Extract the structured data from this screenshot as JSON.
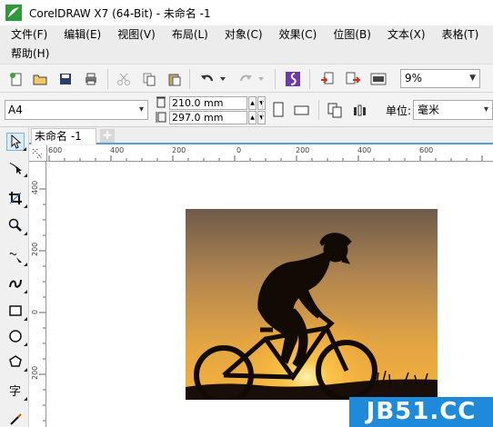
{
  "window": {
    "title": "CorelDRAW X7 (64-Bit) - 未命名 -1"
  },
  "menubar": {
    "row1": [
      {
        "label": "文件(F)"
      },
      {
        "label": "编辑(E)"
      },
      {
        "label": "视图(V)"
      },
      {
        "label": "布局(L)"
      },
      {
        "label": "对象(C)"
      },
      {
        "label": "效果(C)"
      },
      {
        "label": "位图(B)"
      },
      {
        "label": "文本(X)"
      },
      {
        "label": "表格(T)"
      }
    ],
    "row2": [
      {
        "label": "帮助(H)"
      }
    ]
  },
  "toolbar": {
    "zoom": "9%",
    "icons": [
      "new-icon",
      "open-icon",
      "save-icon",
      "print-icon",
      "cut-icon",
      "copy-icon",
      "paste-icon",
      "undo-icon",
      "redo-icon",
      "search-content-icon",
      "import-icon",
      "export-icon",
      "publish-pdf-icon"
    ]
  },
  "property_bar": {
    "page_size": "A4",
    "width": "210.0 mm",
    "height": "297.0 mm",
    "unit_label": "单位:",
    "unit_value": "毫米"
  },
  "document": {
    "tab_label": "未命名 -1",
    "tab_add": "+"
  },
  "rulers": {
    "horizontal": [
      "600",
      "400",
      "200",
      "0",
      "200",
      "400",
      "600"
    ],
    "vertical": [
      "400",
      "200",
      "0",
      "200"
    ]
  },
  "colors": {
    "accent": "#56a0d8",
    "watermark": "#1f8ad9",
    "sunset_top": "#8a6c4f",
    "sunset_glow": "#f0b041"
  },
  "watermark": {
    "text": "JB51.CC"
  }
}
